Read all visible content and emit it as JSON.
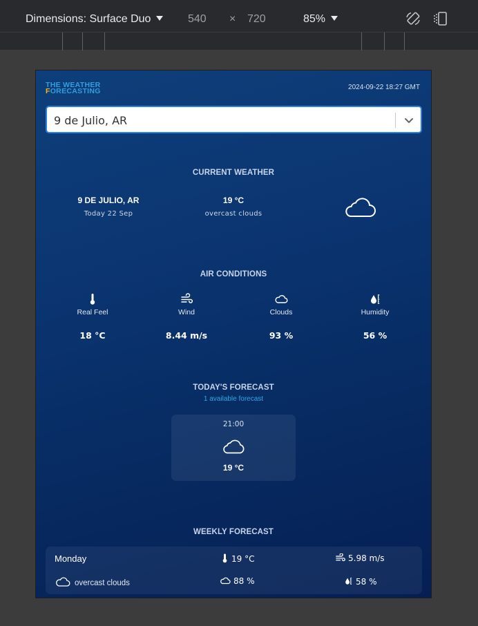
{
  "devtools": {
    "dimensions_label": "Dimensions: Surface Duo",
    "width": "540",
    "times": "×",
    "height": "720",
    "zoom": "85%",
    "icons": [
      "rotate-icon",
      "dual-screen-icon"
    ]
  },
  "app": {
    "logo_line1": "THE WEATHER",
    "logo_f": "F",
    "logo_line2_rest": "ORECASTING",
    "datetime": "2024-09-22 18:27 GMT",
    "search": {
      "value": "9 de Julio, AR"
    },
    "colors": {
      "accent": "#2fa8e0",
      "logo_yellow": "#f5b814",
      "input_border": "#2a7fe0"
    }
  },
  "current": {
    "title": "CURRENT WEATHER",
    "city": "9 DE JULIO, AR",
    "date": "Today 22 Sep",
    "temp": "19 °C",
    "description": "overcast clouds",
    "icon": "cloud-icon"
  },
  "air": {
    "title": "AIR CONDITIONS",
    "items": [
      {
        "label": "Real Feel",
        "value": "18 °C",
        "icon": "thermometer-icon"
      },
      {
        "label": "Wind",
        "value": "8.44 m/s",
        "icon": "wind-icon"
      },
      {
        "label": "Clouds",
        "value": "93 %",
        "icon": "cloud-icon"
      },
      {
        "label": "Humidity",
        "value": "56 %",
        "icon": "humidity-icon"
      }
    ]
  },
  "today": {
    "title": "TODAY'S FORECAST",
    "subtitle": "1 available forecast",
    "items": [
      {
        "time": "21:00",
        "temp": "19 °C",
        "icon": "cloud-icon"
      }
    ]
  },
  "weekly": {
    "title": "WEEKLY FORECAST",
    "days": [
      {
        "day": "Monday",
        "temp": "19 °C",
        "wind": "5.98 m/s",
        "description": "overcast clouds",
        "clouds": "88 %",
        "humidity": "58 %"
      }
    ]
  }
}
